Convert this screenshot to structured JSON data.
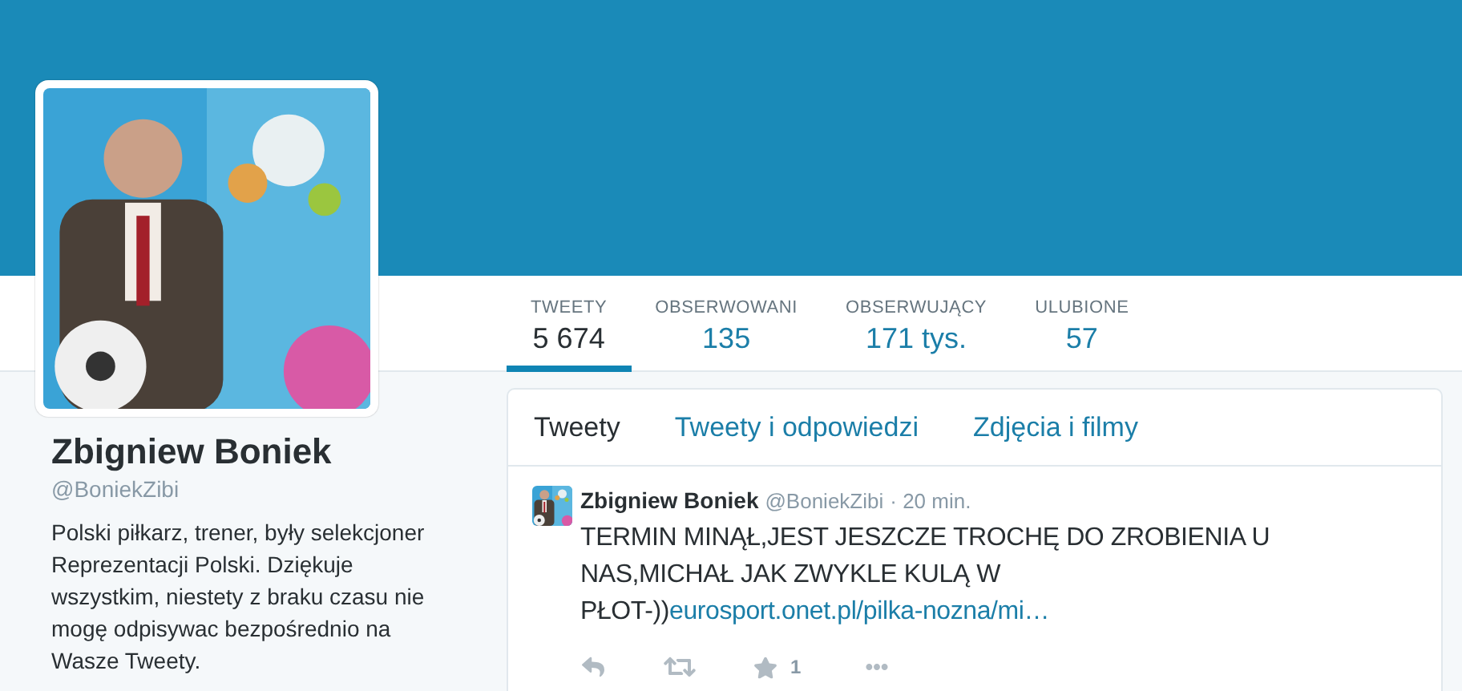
{
  "profile": {
    "name": "Zbigniew Boniek",
    "handle": "@BoniekZibi",
    "bio": "Polski piłkarz, trener, były selekcjoner Reprezentacji Polski. Dziękuje wszystkim, niestety z braku czasu nie mogę odpisywac bezpośrednio na Wasze Tweety."
  },
  "stats": [
    {
      "label": "TWEETY",
      "value": "5 674",
      "selected": true
    },
    {
      "label": "OBSERWOWANI",
      "value": "135",
      "selected": false
    },
    {
      "label": "OBSERWUJĄCY",
      "value": "171 tys.",
      "selected": false
    },
    {
      "label": "ULUBIONE",
      "value": "57",
      "selected": false
    }
  ],
  "timeline_tabs": [
    {
      "label": "Tweety",
      "selected": true
    },
    {
      "label": "Tweety i odpowiedzi",
      "selected": false
    },
    {
      "label": "Zdjęcia i filmy",
      "selected": false
    }
  ],
  "tweets": [
    {
      "name": "Zbigniew Boniek",
      "handle": "@BoniekZibi",
      "time": "· 20 min.",
      "text": "TERMIN MINĄŁ,JEST JESZCZE TROCHĘ DO ZROBIENIA U NAS,MICHAŁ JAK ZWYKLE KULĄ W PŁOT-))",
      "link": "eurosport.onet.pl/pilka-nozna/mi…",
      "favorites": "1"
    }
  ]
}
